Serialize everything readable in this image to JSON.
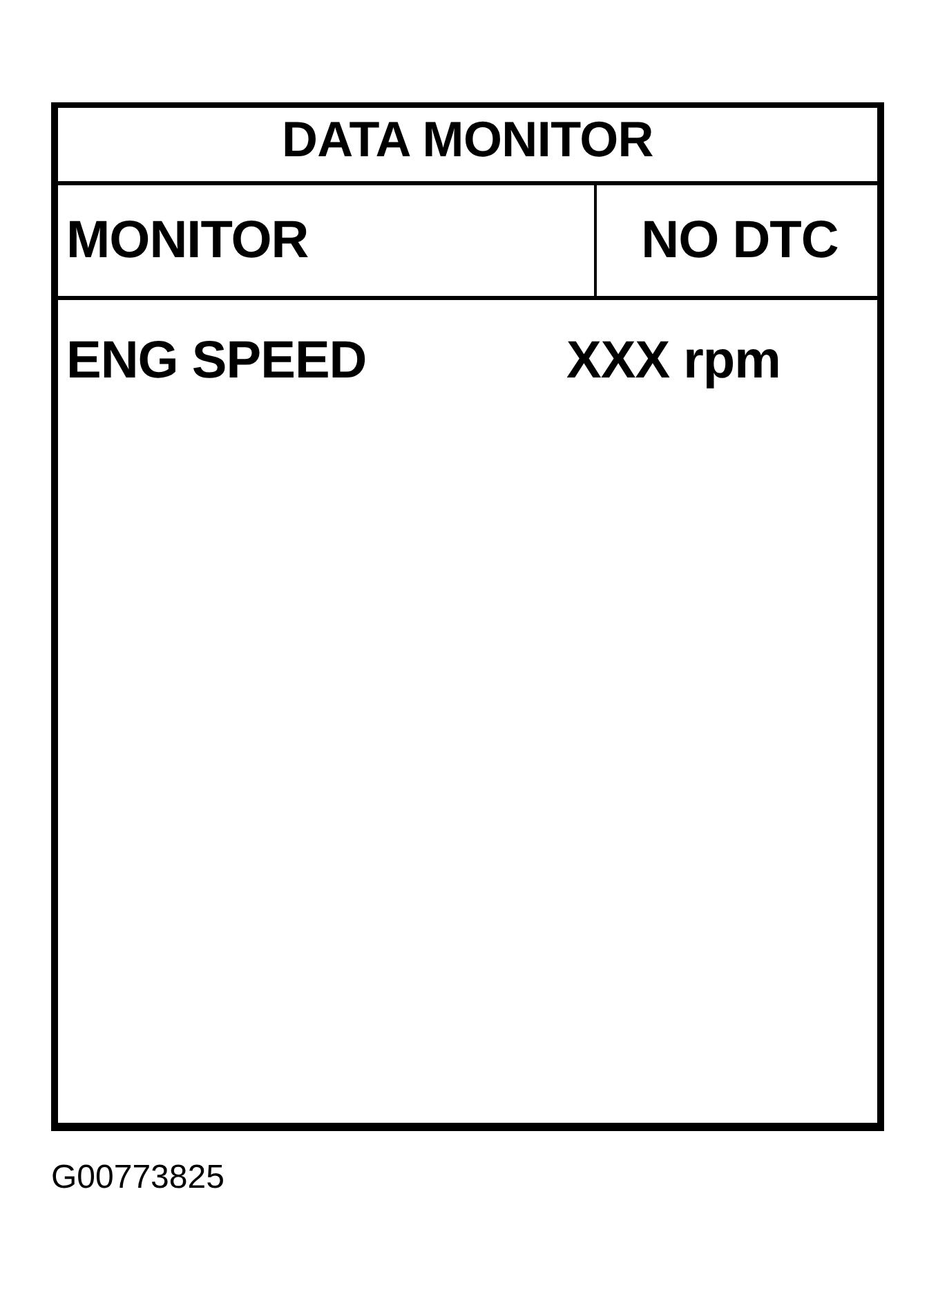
{
  "title": "DATA MONITOR",
  "header": {
    "label": "MONITOR",
    "status": "NO DTC"
  },
  "rows": [
    {
      "name": "ENG SPEED",
      "value": "XXX rpm"
    }
  ],
  "figure_id": "G00773825"
}
